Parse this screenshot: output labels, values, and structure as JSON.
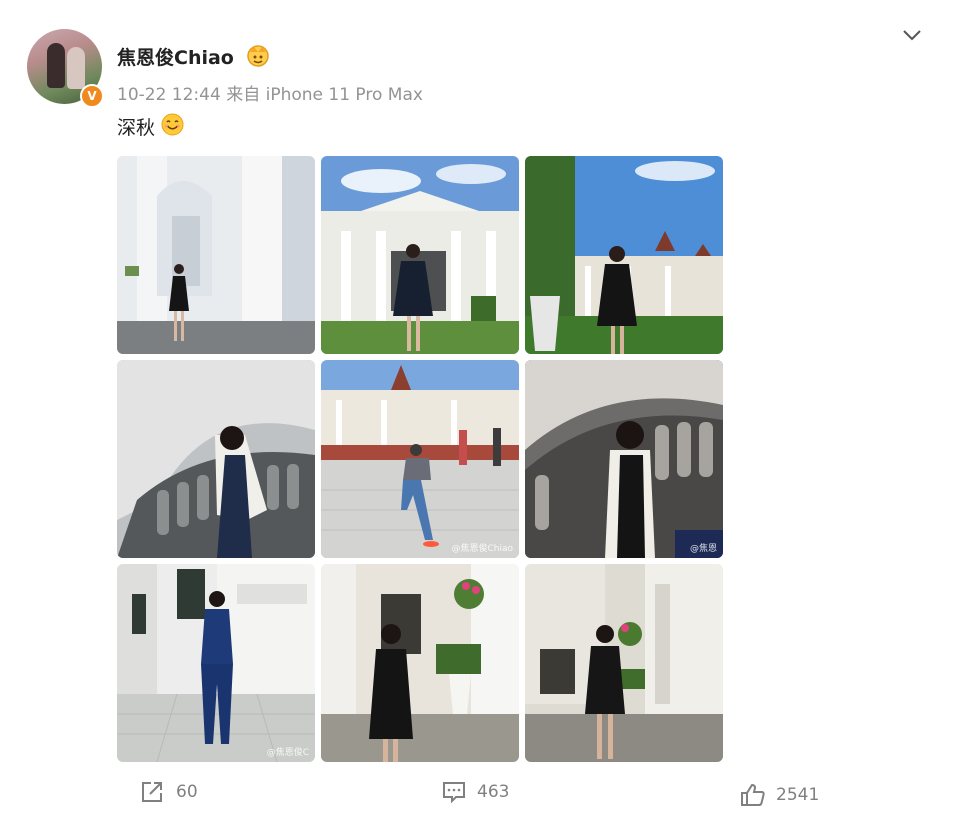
{
  "post": {
    "username": "焦恩俊Chiao",
    "verified_mark": "V",
    "meta": "10-22 12:44  来自 iPhone 11 Pro Max",
    "text": "深秋",
    "menu_icon": "chevron-down-icon",
    "badge_icon": "crown-member-icon",
    "emoji_icon": "smile-emoji-icon"
  },
  "photos": [
    {
      "watermark": ""
    },
    {
      "watermark": ""
    },
    {
      "watermark": ""
    },
    {
      "watermark": ""
    },
    {
      "watermark": "@焦恩俊Chiao"
    },
    {
      "watermark": "@焦恩"
    },
    {
      "watermark": "@焦恩俊C"
    },
    {
      "watermark": ""
    },
    {
      "watermark": ""
    }
  ],
  "actions": {
    "repost_count": "60",
    "comment_count": "463",
    "like_count": "2541"
  },
  "colors": {
    "accent_verified": "#f08a1e",
    "meta_text": "#939393",
    "action_text": "#808080"
  }
}
